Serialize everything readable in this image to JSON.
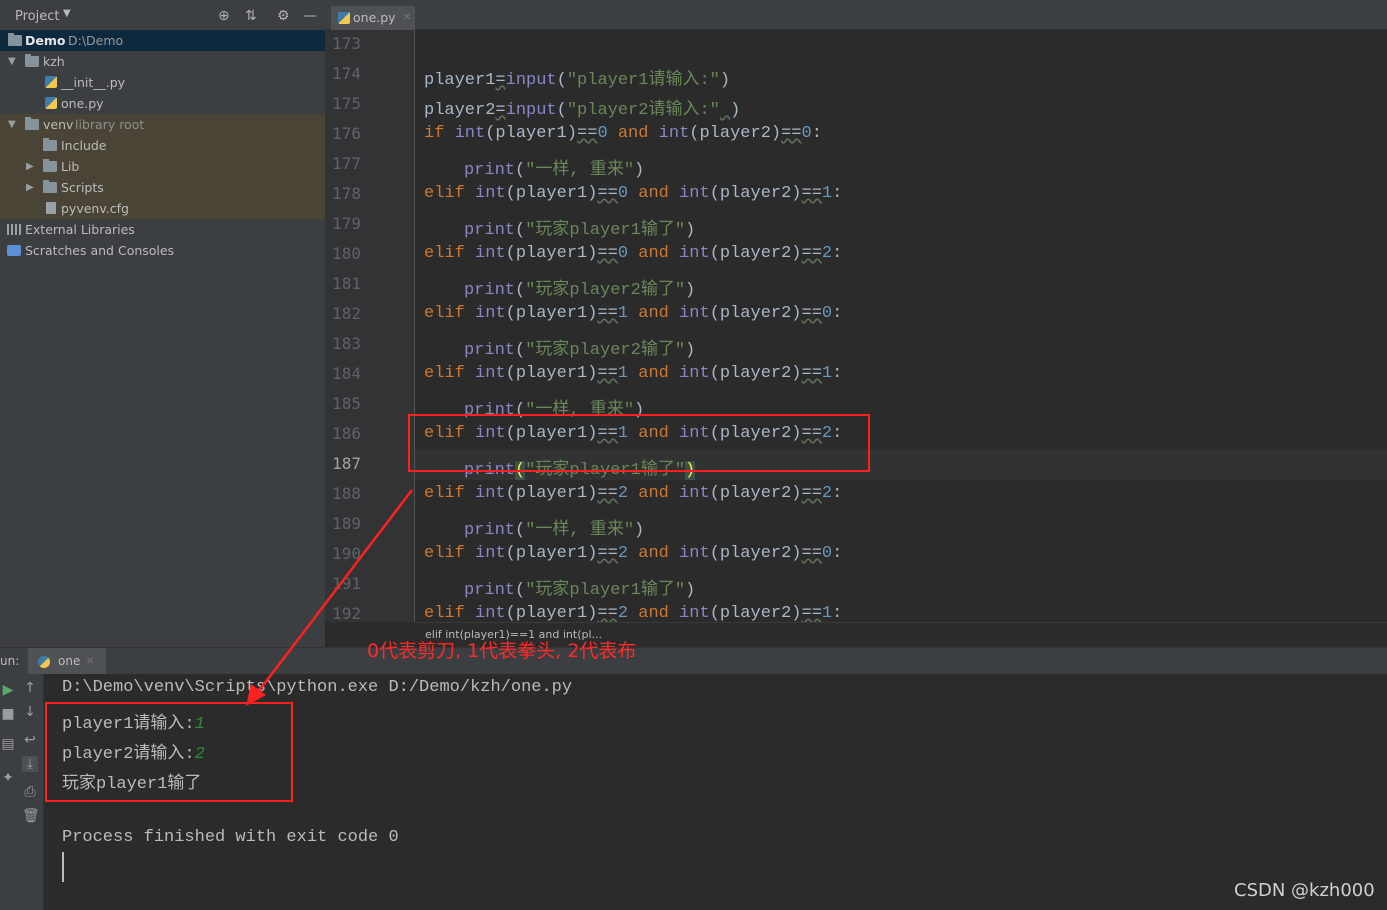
{
  "project_panel": {
    "title": "Project",
    "tree": [
      {
        "label": "Demo",
        "sub": "D:\\Demo"
      },
      {
        "label": "kzh"
      },
      {
        "label": "__init__.py"
      },
      {
        "label": "one.py"
      },
      {
        "label": "venv",
        "sub": "library root"
      },
      {
        "label": "Include"
      },
      {
        "label": "Lib"
      },
      {
        "label": "Scripts"
      },
      {
        "label": "pyvenv.cfg"
      },
      {
        "label": "External Libraries"
      },
      {
        "label": "Scratches and Consoles"
      }
    ]
  },
  "editor": {
    "tab_label": "one.py",
    "current_line": "187",
    "line_numbers": [
      "173",
      "174",
      "175",
      "176",
      "177",
      "178",
      "179",
      "180",
      "181",
      "182",
      "183",
      "184",
      "185",
      "186",
      "187",
      "188",
      "189",
      "190",
      "191",
      "192"
    ],
    "strings": {
      "p1_prompt": "\"player1请输入:\"",
      "p2_prompt": "\"player2请输入:\"",
      "tie": "\"一样, 重来\"",
      "p1_lose": "\"玩家player1输了\"",
      "p2_lose": "\"玩家player2输了\""
    },
    "breadcrumb": "elif int(player1)==1 and int(pl..."
  },
  "run_panel": {
    "label": "un:",
    "tab_label": "one",
    "console": [
      "D:\\Demo\\venv\\Scripts\\python.exe D:/Demo/kzh/one.py",
      "player1请输入:",
      "player2请输入:",
      "玩家player1输了",
      "Process finished with exit code 0"
    ],
    "input_1": "1",
    "input_2": "2"
  },
  "annotation": {
    "note": "0代表剪刀, 1代表拳头, 2代表布",
    "color": "#ff2020"
  },
  "watermark": "CSDN @kzh000"
}
